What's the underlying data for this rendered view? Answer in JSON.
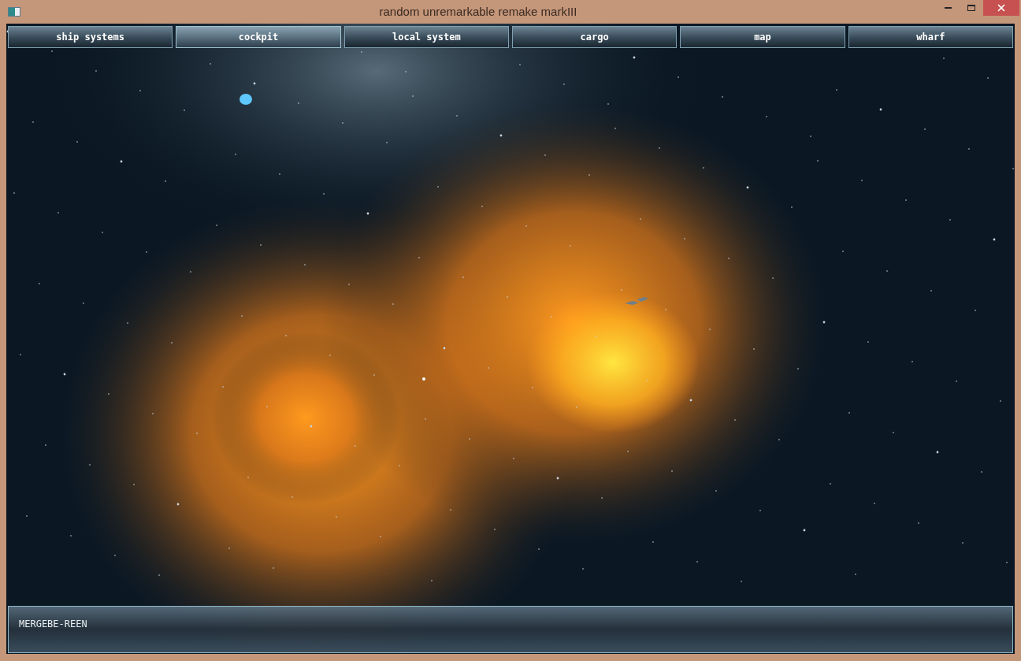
{
  "window": {
    "title": "random unremarkable remake markIII"
  },
  "tabs": [
    {
      "label": "ship systems",
      "selected": false
    },
    {
      "label": "cockpit",
      "selected": true
    },
    {
      "label": "local system",
      "selected": false
    },
    {
      "label": "cargo",
      "selected": false
    },
    {
      "label": "map",
      "selected": false
    },
    {
      "label": "wharf",
      "selected": false
    }
  ],
  "status_panel": {
    "location": "MERGEBE-REEN"
  }
}
